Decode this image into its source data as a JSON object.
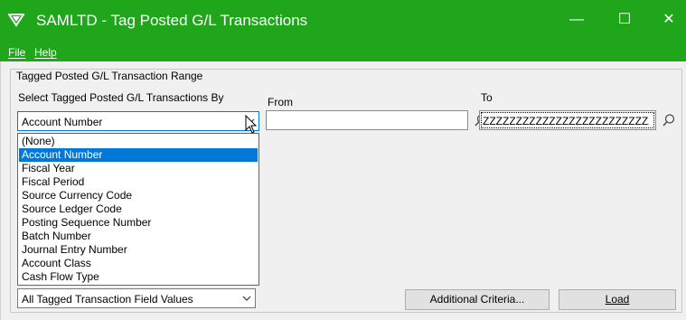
{
  "window": {
    "title": "SAMLTD - Tag Posted G/L Transactions",
    "minimize": "—",
    "maximize": "☐",
    "close": "✕",
    "icon": "sage-logo-icon"
  },
  "menu": {
    "file": "File",
    "help": "Help"
  },
  "range_group": {
    "legend": "Tagged Posted G/L Transaction Range",
    "select_by_label": "Select Tagged Posted G/L Transactions By",
    "from_label": "From",
    "to_label": "To",
    "select_by_value": "Account Number",
    "from_value": "",
    "to_value": "ZZZZZZZZZZZZZZZZZZZZZZZZZZZZZZZZZZZZZZZZZZZZ",
    "dropdown_options": [
      "(None)",
      "Account Number",
      "Fiscal Year",
      "Fiscal Period",
      "Source Currency Code",
      "Source Ledger Code",
      "Posting Sequence Number",
      "Batch Number",
      "Journal Entry Number",
      "Account Class",
      "Cash Flow Type"
    ],
    "selected_option_index": 1
  },
  "field_values_combo": {
    "value": "All Tagged Transaction Field Values"
  },
  "buttons": {
    "additional_criteria": "Additional Criteria...",
    "load": "Load"
  },
  "colors": {
    "titlebar": "#1fa61b",
    "selection": "#0078d7",
    "client_bg": "#f0f0f0"
  }
}
